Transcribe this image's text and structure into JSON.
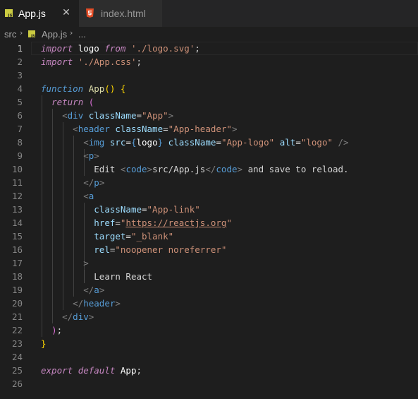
{
  "tabs": [
    {
      "label": "App.js",
      "icon": "js-file-icon",
      "active": true
    },
    {
      "label": "index.html",
      "icon": "html5-file-icon",
      "active": false
    }
  ],
  "breadcrumb": {
    "folder": "src",
    "file": "App.js",
    "more": "..."
  },
  "line_numbers": [
    "1",
    "2",
    "3",
    "4",
    "5",
    "6",
    "7",
    "8",
    "9",
    "10",
    "11",
    "12",
    "13",
    "14",
    "15",
    "16",
    "17",
    "18",
    "19",
    "20",
    "21",
    "22",
    "23",
    "24",
    "25",
    "26"
  ],
  "code": {
    "l1": {
      "kw_import": "import",
      "name": "logo",
      "kw_from": "from",
      "path": "'./logo.svg'",
      "semi": ";"
    },
    "l2": {
      "kw_import": "import",
      "path": "'./App.css'",
      "semi": ";"
    },
    "l4": {
      "kw_function": "function",
      "name": "App",
      "parens": "()",
      "brace": "{"
    },
    "l5": {
      "kw_return": "return",
      "paren": "("
    },
    "l6": {
      "open": "<",
      "tag": "div",
      "attr": "className",
      "eq": "=",
      "value": "\"App\"",
      "close": ">"
    },
    "l7": {
      "open": "<",
      "tag": "header",
      "attr": "className",
      "eq": "=",
      "value": "\"App-header\"",
      "close": ">"
    },
    "l8": {
      "open": "<",
      "tag": "img",
      "attr_src": "src",
      "eq": "=",
      "lb": "{",
      "src_val": "logo",
      "rb": "}",
      "attr_class": "className",
      "class_val": "\"App-logo\"",
      "attr_alt": "alt",
      "alt_val": "\"logo\"",
      "close": "/>"
    },
    "l9": {
      "open": "<",
      "tag": "p",
      "close": ">"
    },
    "l10": {
      "text1": "Edit ",
      "code_open": "<",
      "code_tag": "code",
      "code_close": ">",
      "code_text": "src/App.js",
      "code_end_open": "</",
      "code_end_tag": "code",
      "code_end_close": ">",
      "text2": " and save to reload."
    },
    "l11": {
      "open": "</",
      "tag": "p",
      "close": ">"
    },
    "l12": {
      "open": "<",
      "tag": "a"
    },
    "l13": {
      "attr": "className",
      "eq": "=",
      "value": "\"App-link\""
    },
    "l14": {
      "attr": "href",
      "eq": "=",
      "q1": "\"",
      "url": "https://reactjs.org",
      "q2": "\""
    },
    "l15": {
      "attr": "target",
      "eq": "=",
      "value": "\"_blank\""
    },
    "l16": {
      "attr": "rel",
      "eq": "=",
      "value": "\"noopener noreferrer\""
    },
    "l17": {
      "close": ">"
    },
    "l18": {
      "text": "Learn React"
    },
    "l19": {
      "open": "</",
      "tag": "a",
      "close": ">"
    },
    "l20": {
      "open": "</",
      "tag": "header",
      "close": ">"
    },
    "l21": {
      "open": "</",
      "tag": "div",
      "close": ">"
    },
    "l22": {
      "paren": ")",
      "semi": ";"
    },
    "l23": {
      "brace": "}"
    },
    "l25": {
      "kw_export": "export",
      "kw_default": "default",
      "name": "App",
      "semi": ";"
    }
  },
  "colors": {
    "background": "#1e1e1e",
    "tabbar": "#252526",
    "keyword": "#c586c0",
    "tag": "#569cd6",
    "attribute": "#9cdcfe",
    "string": "#ce9178",
    "function": "#dcdcaa"
  }
}
